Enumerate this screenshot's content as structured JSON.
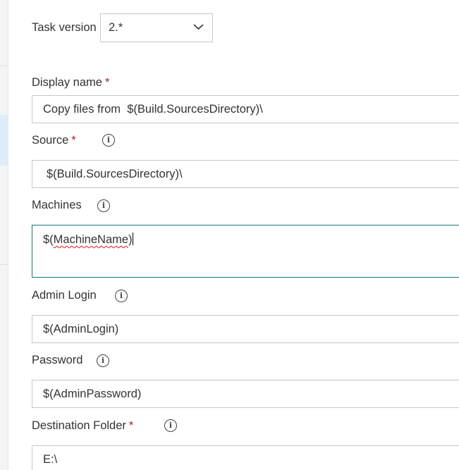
{
  "task_version": {
    "label": "Task version",
    "value": "2.*"
  },
  "display_name": {
    "label": "Display name",
    "required_mark": "*",
    "value": "Copy files from  $(Build.SourcesDirectory)\\"
  },
  "source": {
    "label": "Source",
    "required_mark": "*",
    "value": "$(Build.SourcesDirectory)\\"
  },
  "machines": {
    "label": "Machines",
    "value_prefix": "$(",
    "value_misspelled": "MachineName",
    "value_suffix": ")"
  },
  "admin_login": {
    "label": "Admin Login",
    "value": "$(AdminLogin)"
  },
  "password": {
    "label": "Password",
    "value": "$(AdminPassword)"
  },
  "destination_folder": {
    "label": "Destination Folder",
    "required_mark": "*",
    "value": "E:\\"
  },
  "icons": {
    "info": "i"
  },
  "colors": {
    "required": "#a4262c",
    "focus_border": "#117a7a",
    "selected_nav": "#deecf9"
  }
}
